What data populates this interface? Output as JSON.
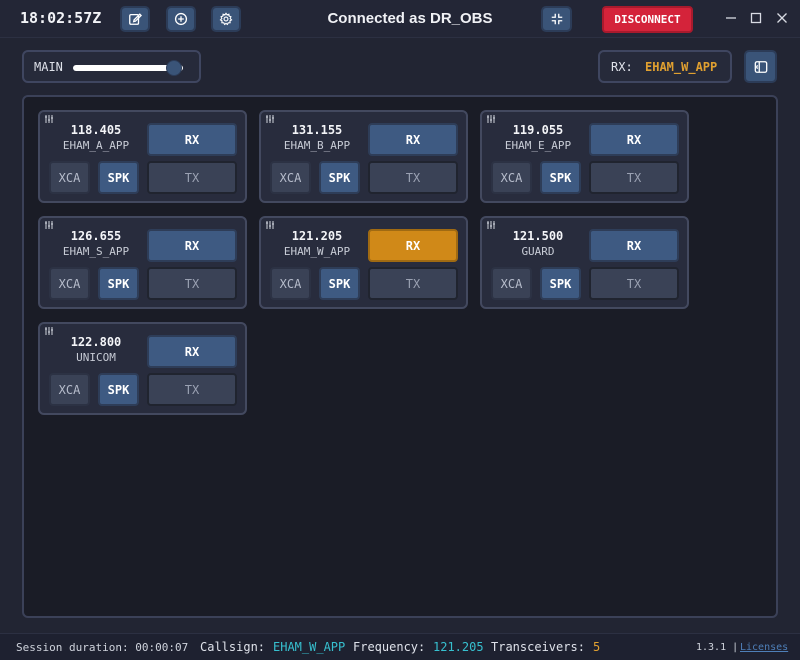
{
  "titlebar": {
    "clock": "18:02:57Z",
    "status": "Connected as DR_OBS",
    "disconnect_label": "DISCONNECT"
  },
  "controls": {
    "main_label": "MAIN",
    "main_volume_fraction": 0.92,
    "rx_label": "RX:",
    "rx_value": "EHAM_W_APP"
  },
  "transceivers": [
    {
      "freq": "118.405",
      "name": "EHAM_A_APP",
      "rx_active": false,
      "rx": "RX",
      "xca": "XCA",
      "spk": "SPK",
      "tx": "TX"
    },
    {
      "freq": "131.155",
      "name": "EHAM_B_APP",
      "rx_active": false,
      "rx": "RX",
      "xca": "XCA",
      "spk": "SPK",
      "tx": "TX"
    },
    {
      "freq": "119.055",
      "name": "EHAM_E_APP",
      "rx_active": false,
      "rx": "RX",
      "xca": "XCA",
      "spk": "SPK",
      "tx": "TX"
    },
    {
      "freq": "126.655",
      "name": "EHAM_S_APP",
      "rx_active": false,
      "rx": "RX",
      "xca": "XCA",
      "spk": "SPK",
      "tx": "TX"
    },
    {
      "freq": "121.205",
      "name": "EHAM_W_APP",
      "rx_active": true,
      "rx": "RX",
      "xca": "XCA",
      "spk": "SPK",
      "tx": "TX"
    },
    {
      "freq": "121.500",
      "name": "GUARD",
      "rx_active": false,
      "rx": "RX",
      "xca": "XCA",
      "spk": "SPK",
      "tx": "TX"
    },
    {
      "freq": "122.800",
      "name": "UNICOM",
      "rx_active": false,
      "rx": "RX",
      "xca": "XCA",
      "spk": "SPK",
      "tx": "TX"
    }
  ],
  "footer": {
    "session": "Session duration: 00:00:07",
    "callsign_label": "Callsign:",
    "callsign_value": "EHAM_W_APP",
    "frequency_label": "Frequency:",
    "frequency_value": "121.205",
    "transceivers_label": "Transceivers:",
    "transceivers_value": "5",
    "version": "1.3.1 |",
    "licenses": "Licenses"
  },
  "colors": {
    "accent_blue": "#3e5a82",
    "rx_active": "#d08918",
    "disconnect": "#d4233a",
    "highlight_orange": "#e0a030",
    "highlight_cyan": "#37c0cf"
  }
}
